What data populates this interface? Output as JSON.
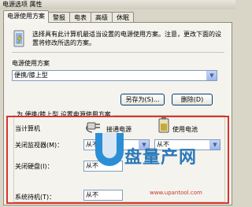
{
  "window": {
    "title": "电源选项 属性"
  },
  "tabs": [
    {
      "label": "电源使用方案",
      "active": true
    },
    {
      "label": "警报",
      "active": false
    },
    {
      "label": "电表",
      "active": false
    },
    {
      "label": "高级",
      "active": false
    },
    {
      "label": "休眠",
      "active": false
    }
  ],
  "description": "选择具有此计算机最适当设置的电源使用方案。注意，更改下面的设置将修改所选的方案。",
  "scheme": {
    "group_label": "电源使用方案",
    "selected": "便携/膝上型",
    "save_as_label": "另存为(S)...",
    "delete_label": "删除(D)"
  },
  "settings": {
    "group_title": "为 便携/膝上型 设置电源使用方案",
    "column_label": "当计算机",
    "plugged_in_label": "接通电源",
    "battery_label": "使用电池",
    "rows": [
      {
        "label": "关闭监视器(M)：",
        "plugged": "从不",
        "battery": "从不"
      },
      {
        "label": "关闭硬盘(I)：",
        "plugged": "从不",
        "battery": ""
      },
      {
        "label": "系统待机(T)：",
        "plugged": "从不",
        "battery": ""
      }
    ]
  },
  "watermark": {
    "brand": "盘量产网",
    "url": "www.upantool.com"
  },
  "colors": {
    "highlight": "#d9342b",
    "accent": "#2b8fd6"
  }
}
